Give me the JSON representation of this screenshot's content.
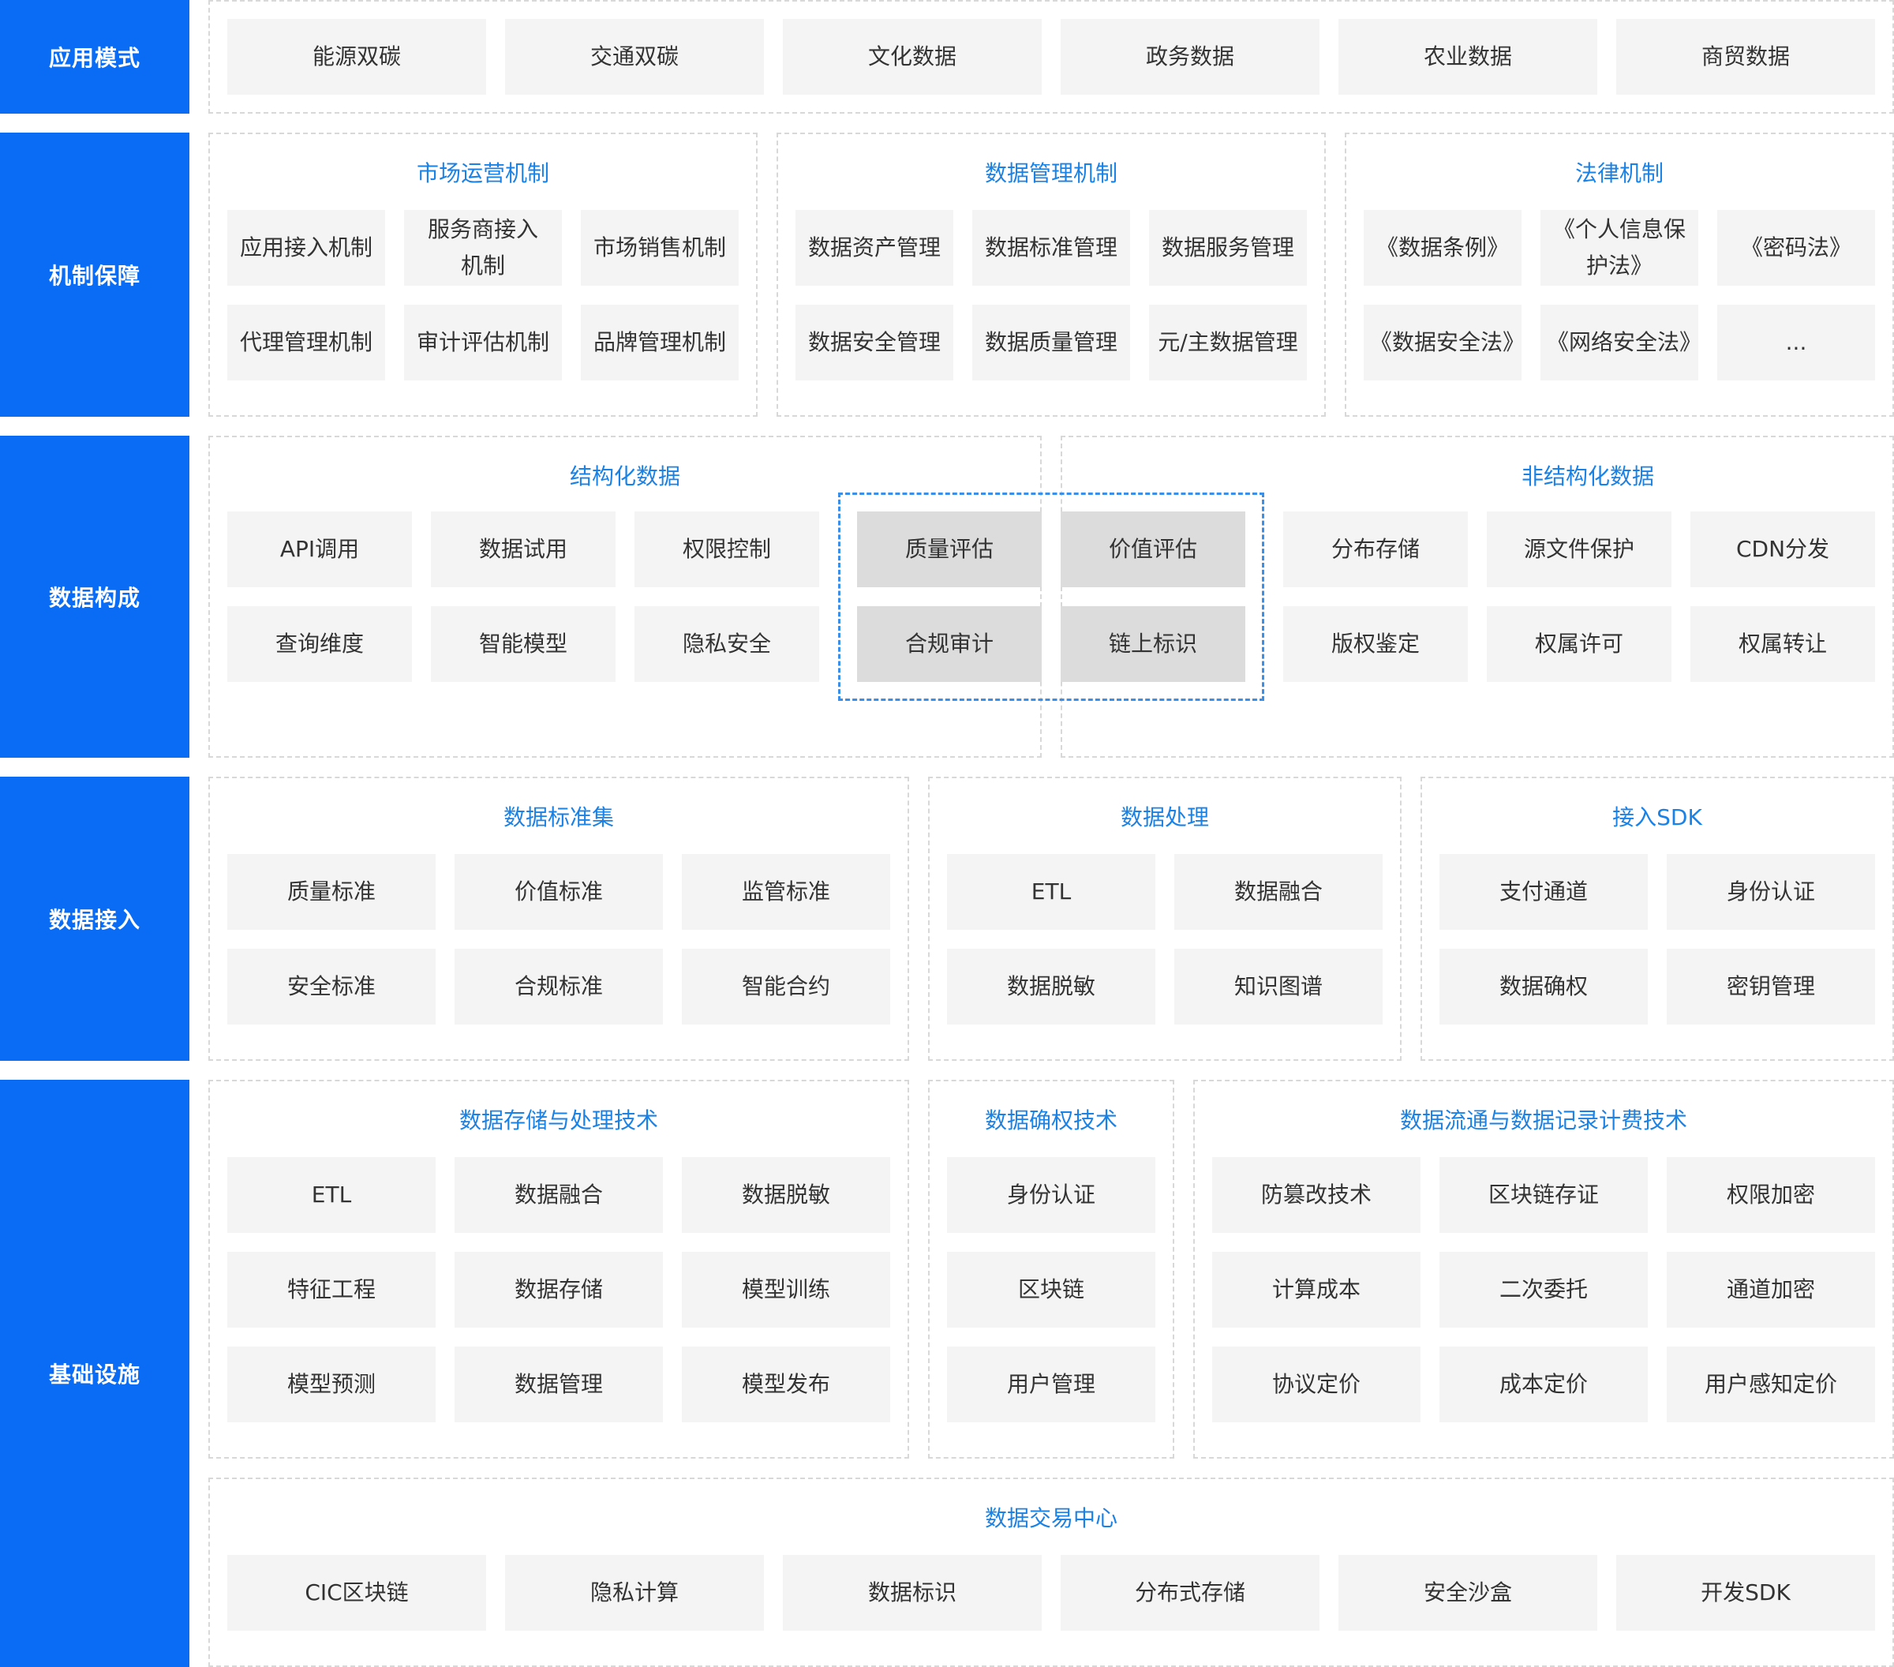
{
  "layers": {
    "app_mode": "应用模式",
    "mechanism": "机制保障",
    "data_composition": "数据构成",
    "data_access": "数据接入",
    "infrastructure": "基础设施"
  },
  "app_mode": {
    "items": [
      "能源双碳",
      "交通双碳",
      "文化数据",
      "政务数据",
      "农业数据",
      "商贸数据"
    ]
  },
  "mechanism": {
    "market": {
      "title": "市场运营机制",
      "items": [
        "应用接入机制",
        "服务商接入机制",
        "市场销售机制",
        "代理管理机制",
        "审计评估机制",
        "品牌管理机制"
      ]
    },
    "data_mgmt": {
      "title": "数据管理机制",
      "items": [
        "数据资产管理",
        "数据标准管理",
        "数据服务管理",
        "数据安全管理",
        "数据质量管理",
        "元/主数据管理"
      ]
    },
    "law": {
      "title": "法律机制",
      "items": [
        "《数据条例》",
        "《个人信息保护法》",
        "《密码法》",
        "《数据安全法》",
        "《网络安全法》",
        "..."
      ]
    }
  },
  "data_composition": {
    "structured": {
      "title": "结构化数据",
      "items": [
        "API调用",
        "数据试用",
        "权限控制",
        "查询维度",
        "智能模型",
        "隐私安全"
      ]
    },
    "center": {
      "items": [
        "质量评估",
        "价值评估",
        "合规审计",
        "链上标识"
      ]
    },
    "unstructured": {
      "title": "非结构化数据",
      "items": [
        "分布存储",
        "源文件保护",
        "CDN分发",
        "版权鉴定",
        "权属许可",
        "权属转让"
      ]
    }
  },
  "data_access": {
    "standards": {
      "title": "数据标准集",
      "items": [
        "质量标准",
        "价值标准",
        "监管标准",
        "安全标准",
        "合规标准",
        "智能合约"
      ]
    },
    "processing": {
      "title": "数据处理",
      "items": [
        "ETL",
        "数据融合",
        "数据脱敏",
        "知识图谱"
      ]
    },
    "sdk": {
      "title": "接入SDK",
      "items": [
        "支付通道",
        "身份认证",
        "数据确权",
        "密钥管理"
      ]
    }
  },
  "infrastructure": {
    "storage": {
      "title": "数据存储与处理技术",
      "items": [
        "ETL",
        "数据融合",
        "数据脱敏",
        "特征工程",
        "数据存储",
        "模型训练",
        "模型预测",
        "数据管理",
        "模型发布"
      ]
    },
    "rights": {
      "title": "数据确权技术",
      "items": [
        "身份认证",
        "区块链",
        "用户管理"
      ]
    },
    "flow": {
      "title": "数据流通与数据记录计费技术",
      "items": [
        "防篡改技术",
        "区块链存证",
        "权限加密",
        "计算成本",
        "二次委托",
        "通道加密",
        "协议定价",
        "成本定价",
        "用户感知定价"
      ]
    },
    "exchange": {
      "title": "数据交易中心",
      "items": [
        "CIC区块链",
        "隐私计算",
        "数据标识",
        "分布式存储",
        "安全沙盒",
        "开发SDK"
      ]
    }
  }
}
